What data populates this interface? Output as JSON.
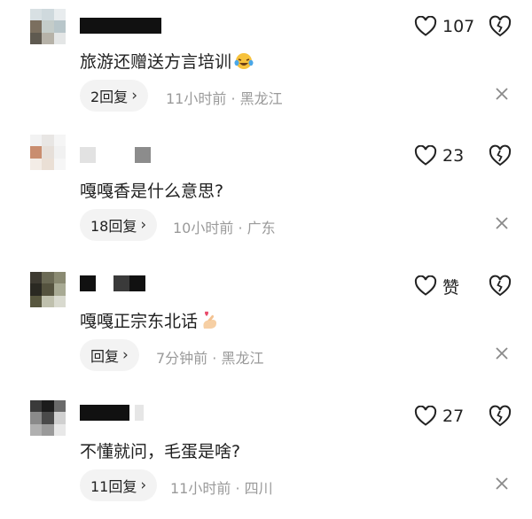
{
  "comments": [
    {
      "text": "旅游还赠送方言培训",
      "emoji": "laughing-crying-face",
      "reply_label": "2回复",
      "time": "11小时前",
      "location": "黑龙江",
      "likes": "107"
    },
    {
      "text": "嘎嘎香是什么意思?",
      "emoji": "",
      "reply_label": "18回复",
      "time": "10小时前",
      "location": "广东",
      "likes": "23"
    },
    {
      "text": "嘎嘎正宗东北话",
      "emoji": "finger-heart",
      "reply_label": "回复",
      "time": "7分钟前",
      "location": "黑龙江",
      "likes": "赞"
    },
    {
      "text": "不懂就问，毛蛋是啥?",
      "emoji": "",
      "reply_label": "11回复",
      "time": "11小时前",
      "location": "四川",
      "likes": "27"
    }
  ],
  "separator": "·"
}
